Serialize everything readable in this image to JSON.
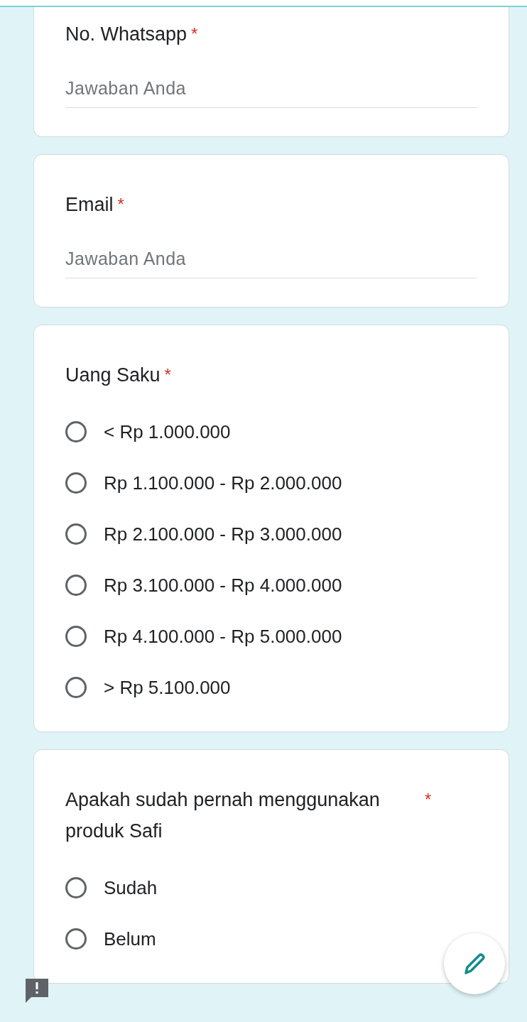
{
  "questions": [
    {
      "kind": "text",
      "title": "No. Whatsapp",
      "required_mark": "*",
      "placeholder": "Jawaban Anda"
    },
    {
      "kind": "text",
      "title": "Email",
      "required_mark": "*",
      "placeholder": "Jawaban Anda"
    },
    {
      "kind": "radio",
      "title": "Uang Saku",
      "required_mark": "*",
      "options": [
        {
          "label": "< Rp 1.000.000",
          "selected": false
        },
        {
          "label": "Rp 1.100.000 - Rp 2.000.000",
          "selected": false
        },
        {
          "label": "Rp 2.100.000 - Rp 3.000.000",
          "selected": false
        },
        {
          "label": "Rp 3.100.000 - Rp 4.000.000",
          "selected": false
        },
        {
          "label": "Rp 4.100.000 - Rp 5.000.000",
          "selected": false
        },
        {
          "label": "> Rp 5.100.000",
          "selected": false
        }
      ]
    },
    {
      "kind": "radio",
      "title": "Apakah sudah pernah menggunakan produk Safi",
      "required_mark": "*",
      "options": [
        {
          "label": "Sudah",
          "selected": false
        },
        {
          "label": "Belum",
          "selected": false
        }
      ]
    }
  ]
}
